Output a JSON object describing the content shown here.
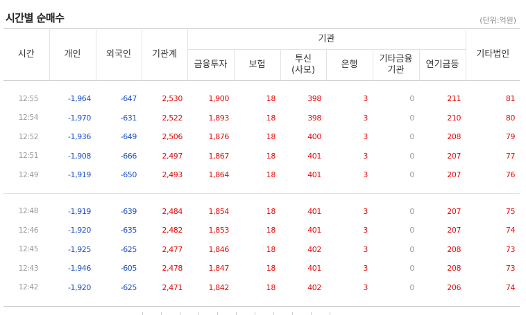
{
  "title": "시간별 순매수",
  "unit": "(단위:억원)",
  "headers": {
    "time": "시간",
    "individual": "개인",
    "foreign": "외국인",
    "institution_total": "기관계",
    "institution_group": "기관",
    "financial_investment": "금융투자",
    "insurance": "보험",
    "investment_trust": "투신\n(사모)",
    "bank": "은행",
    "other_financial": "기타금융\n기관",
    "pension": "연기금등",
    "other_corp": "기타법인"
  },
  "group1": [
    [
      "12:55",
      "-1,964",
      "-647",
      "2,530",
      "1,900",
      "18",
      "398",
      "3",
      "0",
      "211",
      "81"
    ],
    [
      "12:54",
      "-1,970",
      "-631",
      "2,522",
      "1,893",
      "18",
      "398",
      "3",
      "0",
      "210",
      "80"
    ],
    [
      "12:52",
      "-1,936",
      "-649",
      "2,506",
      "1,876",
      "18",
      "400",
      "3",
      "0",
      "208",
      "79"
    ],
    [
      "12:51",
      "-1,908",
      "-666",
      "2,497",
      "1,867",
      "18",
      "401",
      "3",
      "0",
      "207",
      "77"
    ],
    [
      "12:49",
      "-1,919",
      "-650",
      "2,493",
      "1,864",
      "18",
      "401",
      "3",
      "0",
      "207",
      "76"
    ]
  ],
  "group2": [
    [
      "12:48",
      "-1,919",
      "-639",
      "2,484",
      "1,854",
      "18",
      "401",
      "3",
      "0",
      "207",
      "75"
    ],
    [
      "12:46",
      "-1,920",
      "-635",
      "2,482",
      "1,853",
      "18",
      "401",
      "3",
      "0",
      "207",
      "74"
    ],
    [
      "12:45",
      "-1,925",
      "-625",
      "2,477",
      "1,846",
      "18",
      "402",
      "3",
      "0",
      "208",
      "73"
    ],
    [
      "12:43",
      "-1,946",
      "-605",
      "2,478",
      "1,847",
      "18",
      "401",
      "3",
      "0",
      "208",
      "73"
    ],
    [
      "12:42",
      "-1,920",
      "-625",
      "2,471",
      "1,842",
      "18",
      "402",
      "3",
      "0",
      "206",
      "74"
    ]
  ],
  "colors": {
    "negative": "#1b4fc9",
    "positive": "#e00b0b",
    "zero": "#999999"
  }
}
